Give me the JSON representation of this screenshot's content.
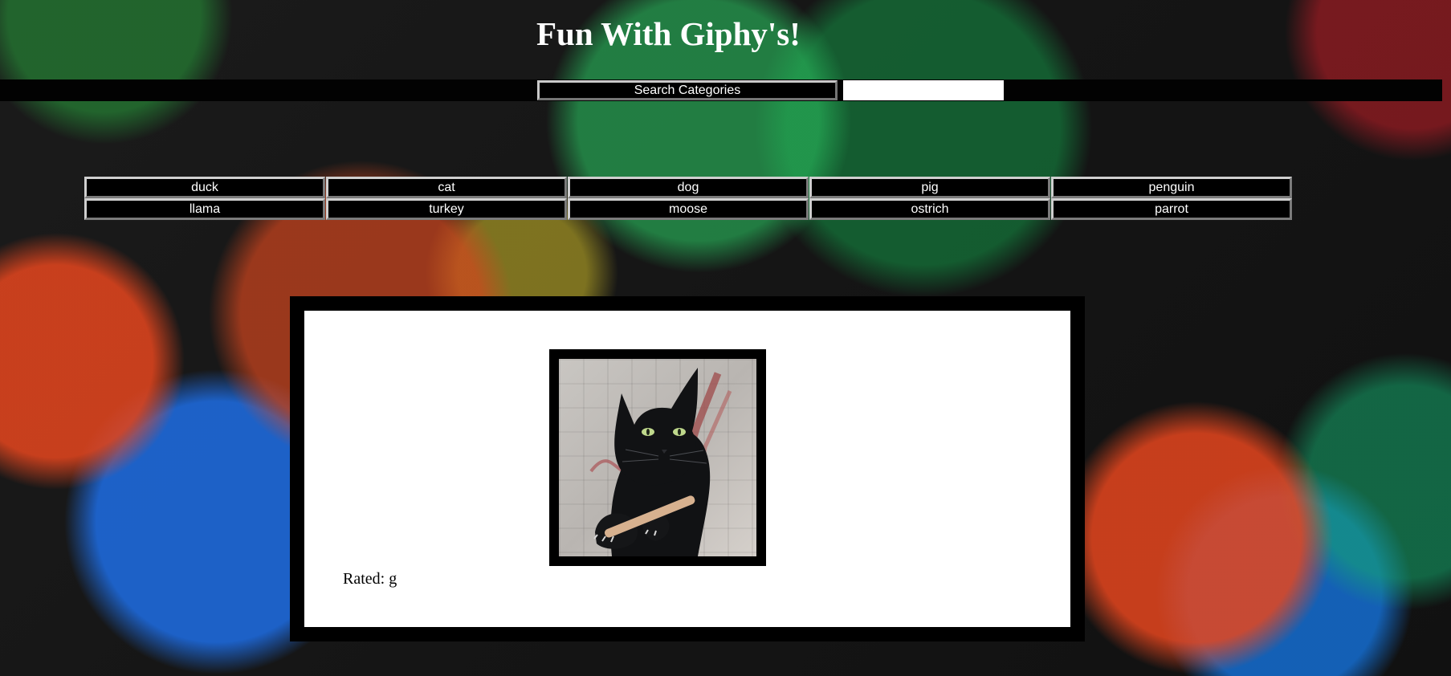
{
  "page": {
    "title": "Fun With Giphy's!"
  },
  "search": {
    "button_label": "Search Categories",
    "input_value": "",
    "input_placeholder": ""
  },
  "categories": {
    "row_1": [
      {
        "label": "duck"
      },
      {
        "label": "cat"
      },
      {
        "label": "dog"
      },
      {
        "label": "pig"
      },
      {
        "label": "penguin"
      }
    ],
    "row_2": [
      {
        "label": "llama"
      },
      {
        "label": "turkey"
      },
      {
        "label": "moose"
      },
      {
        "label": "ostrich"
      },
      {
        "label": "parrot"
      }
    ]
  },
  "result": {
    "image_subject": "black cat holding nail file",
    "rating_label": "Rated: g"
  }
}
